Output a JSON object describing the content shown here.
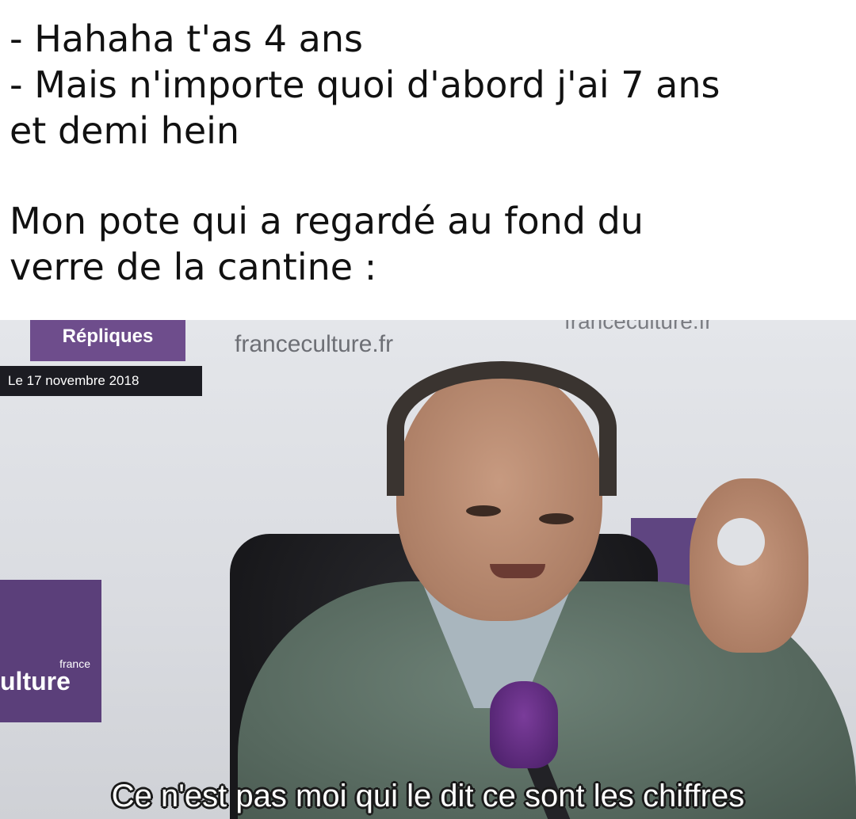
{
  "caption": {
    "line1": "- Hahaha t'as 4 ans",
    "line2": "- Mais n'importe quoi d'abord j'ai 7 ans",
    "line3": "et demi hein",
    "line4": "Mon pote qui a regardé au fond du",
    "line5": "verre de la cantine :"
  },
  "photo": {
    "show_name": "Répliques",
    "date": "Le 17 novembre 2018",
    "website_1": "franceculture.fr",
    "website_2": "franceculture.fr",
    "logo_small": "france",
    "logo_big": "ulture",
    "subtitle": "Ce n'est pas moi qui le dit ce sont les chiffres"
  },
  "colors": {
    "brand_purple": "#6e4d8c",
    "caption_text": "#111111",
    "subtitle_text": "#ffffff"
  }
}
